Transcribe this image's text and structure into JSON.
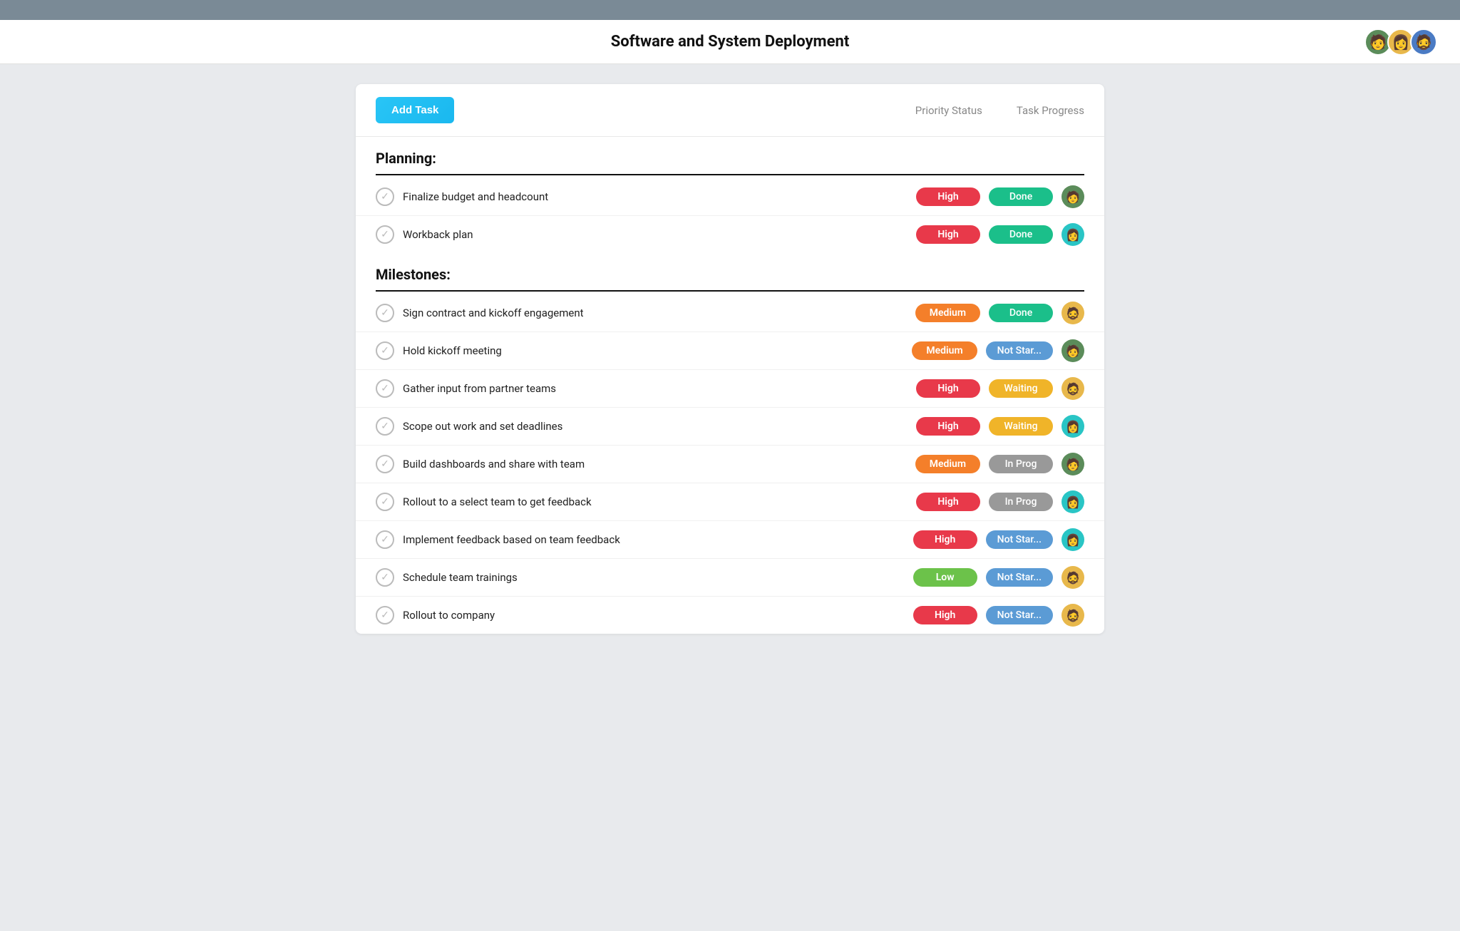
{
  "topBar": {},
  "header": {
    "title": "Software and System Deployment",
    "avatars": [
      {
        "id": "avatar-1",
        "colorClass": "av-green",
        "emoji": "👤"
      },
      {
        "id": "avatar-2",
        "colorClass": "av-yellow",
        "emoji": "👤"
      },
      {
        "id": "avatar-3",
        "colorClass": "av-blue",
        "emoji": "👤"
      }
    ]
  },
  "toolbar": {
    "addTaskLabel": "Add Task",
    "columns": [
      {
        "id": "priority-status",
        "label": "Priority Status"
      },
      {
        "id": "task-progress",
        "label": "Task Progress"
      }
    ]
  },
  "sections": [
    {
      "id": "planning",
      "title": "Planning:",
      "tasks": [
        {
          "id": "task-1",
          "name": "Finalize budget and headcount",
          "priority": "High",
          "priorityClass": "priority-high",
          "status": "Done",
          "statusClass": "status-done",
          "avatarClass": "av-green",
          "avatarEmoji": "👤"
        },
        {
          "id": "task-2",
          "name": "Workback plan",
          "priority": "High",
          "priorityClass": "priority-high",
          "status": "Done",
          "statusClass": "status-done",
          "avatarClass": "av-teal",
          "avatarEmoji": "👤"
        }
      ]
    },
    {
      "id": "milestones",
      "title": "Milestones:",
      "tasks": [
        {
          "id": "task-3",
          "name": "Sign contract and kickoff engagement",
          "priority": "Medium",
          "priorityClass": "priority-medium",
          "status": "Done",
          "statusClass": "status-done",
          "avatarClass": "av-yellow",
          "avatarEmoji": "👤"
        },
        {
          "id": "task-4",
          "name": "Hold kickoff meeting",
          "priority": "Medium",
          "priorityClass": "priority-medium",
          "status": "Not Star...",
          "statusClass": "status-not-started",
          "avatarClass": "av-green",
          "avatarEmoji": "👤"
        },
        {
          "id": "task-5",
          "name": "Gather input from partner teams",
          "priority": "High",
          "priorityClass": "priority-high",
          "status": "Waiting",
          "statusClass": "status-waiting",
          "avatarClass": "av-yellow",
          "avatarEmoji": "👤"
        },
        {
          "id": "task-6",
          "name": "Scope out work and set deadlines",
          "priority": "High",
          "priorityClass": "priority-high",
          "status": "Waiting",
          "statusClass": "status-waiting",
          "avatarClass": "av-teal",
          "avatarEmoji": "👤"
        },
        {
          "id": "task-7",
          "name": "Build dashboards and share with team",
          "priority": "Medium",
          "priorityClass": "priority-medium",
          "status": "In Prog",
          "statusClass": "status-in-prog",
          "avatarClass": "av-green",
          "avatarEmoji": "👤"
        },
        {
          "id": "task-8",
          "name": "Rollout to a select team to get feedback",
          "priority": "High",
          "priorityClass": "priority-high",
          "status": "In Prog",
          "statusClass": "status-in-prog",
          "avatarClass": "av-teal",
          "avatarEmoji": "👤"
        },
        {
          "id": "task-9",
          "name": "Implement feedback based on team feedback",
          "priority": "High",
          "priorityClass": "priority-high",
          "status": "Not Star...",
          "statusClass": "status-not-started",
          "avatarClass": "av-teal",
          "avatarEmoji": "👤"
        },
        {
          "id": "task-10",
          "name": "Schedule team trainings",
          "priority": "Low",
          "priorityClass": "priority-low",
          "status": "Not Star...",
          "statusClass": "status-not-started",
          "avatarClass": "av-yellow",
          "avatarEmoji": "👤"
        },
        {
          "id": "task-11",
          "name": "Rollout to company",
          "priority": "High",
          "priorityClass": "priority-high",
          "status": "Not Star...",
          "statusClass": "status-not-started",
          "avatarClass": "av-yellow",
          "avatarEmoji": "👤"
        }
      ]
    }
  ]
}
